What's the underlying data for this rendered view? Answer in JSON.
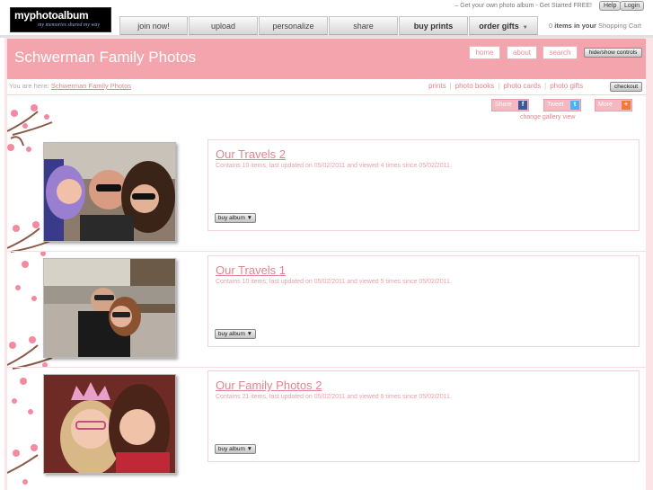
{
  "brand": {
    "wordmark": "myphotoalbum",
    "tagline": "my memories shared my way"
  },
  "top": {
    "promo": "– Get your own photo album - Get Started FREE!",
    "help": "Help",
    "login": "Login"
  },
  "nav": {
    "tabs": [
      "join now!",
      "upload",
      "personalize",
      "share",
      "buy prints",
      "order gifts"
    ],
    "cart_count": "0",
    "cart_items_label": "items in your",
    "cart_label": "Shopping Cart"
  },
  "header": {
    "title": "Schwerman Family Photos",
    "home": "home",
    "about": "about",
    "search": "search",
    "hide_show": "hide/show controls"
  },
  "breadcrumb": {
    "prefix": "You are here:",
    "current": "Schwerman Family Photos"
  },
  "links": {
    "prints": "prints",
    "photo_books": "photo books",
    "photo_cards": "photo cards",
    "photo_gifts": "photo gifts",
    "checkout": "checkout"
  },
  "share": {
    "share": "Share",
    "tweet": "Tweet",
    "more": "More",
    "change_view": "change gallery view"
  },
  "albums": [
    {
      "title": "Our Travels 2",
      "meta": "Contains 10 items, last updated on 05/02/2011 and viewed 4 times since 05/02/2011.",
      "buy": "buy album ▼"
    },
    {
      "title": "Our Travels 1",
      "meta": "Contains 10 items, last updated on 05/02/2011 and viewed 5 times since 05/02/2011.",
      "buy": "buy album ▼"
    },
    {
      "title": "Our Family Photos 2",
      "meta": "Contains 21 items, last updated on 05/02/2011 and viewed 6 times since 05/02/2011.",
      "buy": "buy album ▼"
    }
  ],
  "colors": {
    "accent": "#f3a4ac",
    "link": "#e2848f",
    "background": "#fbe3e6"
  }
}
